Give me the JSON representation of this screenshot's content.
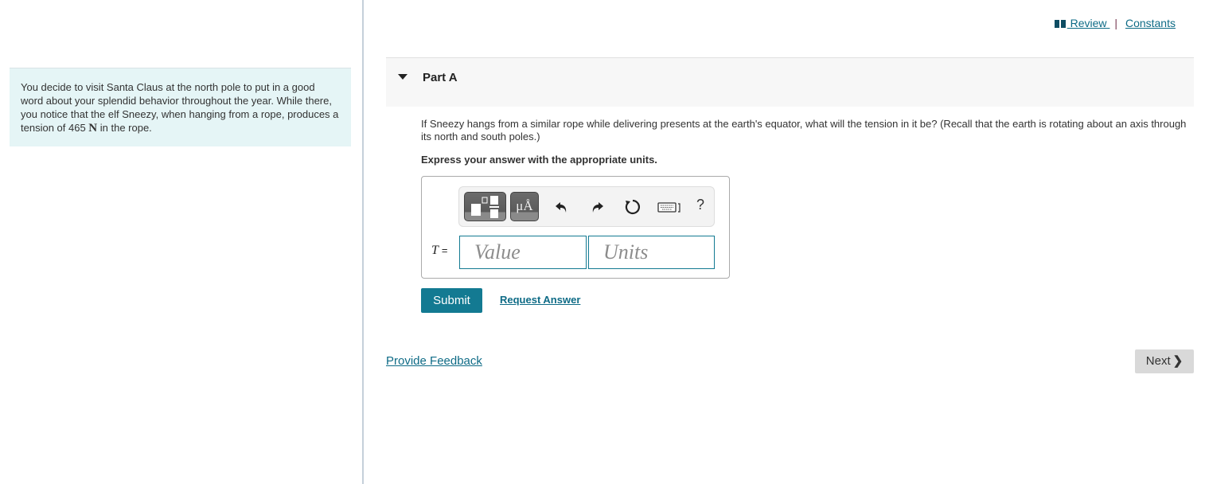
{
  "problem": {
    "intro_text_before": "You decide to visit Santa Claus at the north pole to put in a good word about your splendid behavior throughout the year. While there, you notice that the elf Sneezy, when hanging from a rope, produces a tension of 465 ",
    "intro_unit": "N",
    "intro_text_after": " in the rope."
  },
  "top_links": {
    "review_label": " Review",
    "separator": "|",
    "constants_label": "Constants",
    "review_icon": "book-icon"
  },
  "part": {
    "title": "Part A",
    "expanded": true,
    "question": "If Sneezy hangs from a similar rope while delivering presents at the earth's equator, what will the tension in it be? (Recall that the earth is rotating about an axis through its north and south poles.)",
    "instruction": "Express your answer with the appropriate units."
  },
  "toolbar": {
    "templates_icon": "templates-icon",
    "units_label": "μÅ",
    "undo_icon": "undo-icon",
    "redo_icon": "redo-icon",
    "reset_icon": "reset-icon",
    "keyboard_icon": "keyboard-icon",
    "help_label": "?"
  },
  "answer": {
    "variable": "T",
    "equals": "=",
    "value": "",
    "value_placeholder": "Value",
    "units": "",
    "units_placeholder": "Units"
  },
  "actions": {
    "submit_label": "Submit",
    "request_answer_label": "Request Answer",
    "provide_feedback_label": "Provide Feedback",
    "next_label": "Next",
    "next_chevron": "❯"
  },
  "colors": {
    "accent": "#137a92",
    "link": "#0e6b86",
    "intro_bg": "#e5f5f6",
    "part_header_bg": "#f7f7f7",
    "next_bg": "#d9d9d9"
  }
}
